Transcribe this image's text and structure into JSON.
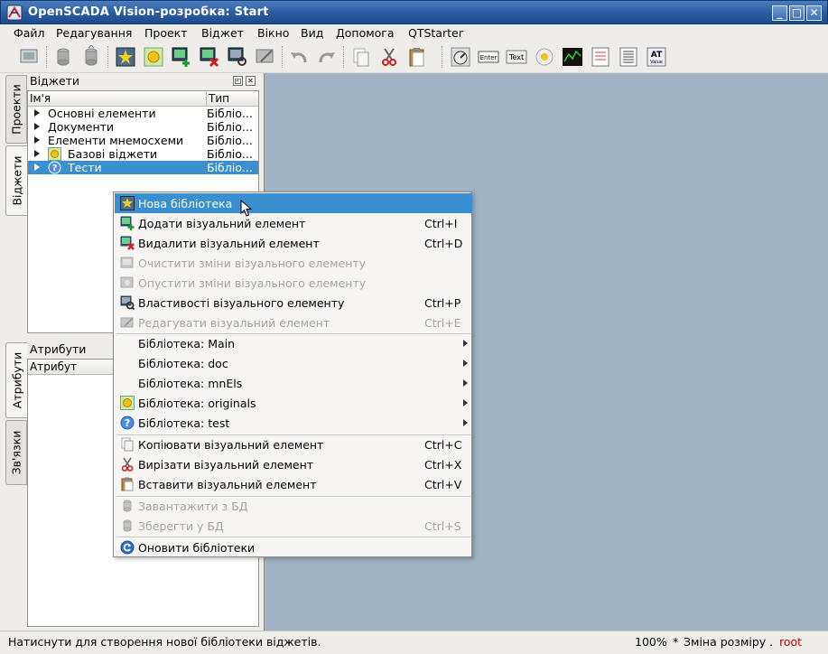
{
  "window": {
    "title": "OpenSCADA Vision-розробка: Start",
    "controls": [
      "_",
      "□",
      "✕"
    ]
  },
  "menubar": [
    "Файл",
    "Редагування",
    "Проект",
    "Віджет",
    "Вікно",
    "Вид",
    "Допомога",
    "QTStarter"
  ],
  "toolbar": {
    "icons": [
      "db-window-icon",
      "load-db-icon",
      "save-db-icon",
      "new-library-icon",
      "library-icon",
      "add-widget-icon",
      "delete-widget-icon",
      "properties-icon",
      "edit-icon",
      "undo-icon",
      "redo-icon",
      "copy-icon",
      "cut-icon",
      "paste-icon",
      "lib-gauge-icon",
      "lib-input-icon",
      "lib-text-icon",
      "lib-flower-icon",
      "lib-trend-icon",
      "lib-doc-icon",
      "lib-table-icon",
      "lib-value-icon"
    ],
    "text_badges": {
      "input": "Enter",
      "text": "Text",
      "value": "Value"
    }
  },
  "left_tabs": {
    "top": [
      "Проекти",
      "Віджети"
    ],
    "bottom": [
      "Атрибути",
      "Зв'язки"
    ]
  },
  "widgets_panel": {
    "title": "Віджети",
    "columns": [
      "Ім'я",
      "Тип"
    ],
    "rows": [
      {
        "name": "Основні елементи",
        "type": "Бібліо..."
      },
      {
        "name": "Документи",
        "type": "Бібліо..."
      },
      {
        "name": "Елементи мнемосхеми",
        "type": "Бібліо..."
      },
      {
        "name": "Базові віджети",
        "type": "Бібліо..."
      },
      {
        "name": "Тести",
        "type": "Бібліо..."
      }
    ]
  },
  "attributes_panel": {
    "title": "Атрибути",
    "columns": [
      "Атрибут"
    ]
  },
  "context_menu": {
    "items": [
      {
        "label": "Нова бібліотека",
        "shortcut": "",
        "icon": "new-library-icon"
      },
      {
        "label": "Додати візуальний елемент",
        "shortcut": "Ctrl+I",
        "icon": "add-widget-icon"
      },
      {
        "label": "Видалити візуальний елемент",
        "shortcut": "Ctrl+D",
        "icon": "delete-widget-icon"
      },
      {
        "label": "Очистити зміни візуального елементу",
        "shortcut": "",
        "icon": "clear-changes-icon"
      },
      {
        "label": "Опустити зміни візуального елементу",
        "shortcut": "",
        "icon": "drop-changes-icon"
      },
      {
        "label": "Властивості візуального елементу",
        "shortcut": "Ctrl+P",
        "icon": "properties-icon"
      },
      {
        "label": "Редагувати візуальний елемент",
        "shortcut": "Ctrl+E",
        "icon": "edit-icon"
      },
      {
        "label": "Бібліотека: Main",
        "shortcut": "",
        "icon": ""
      },
      {
        "label": "Бібліотека: doc",
        "shortcut": "",
        "icon": ""
      },
      {
        "label": "Бібліотека: mnEls",
        "shortcut": "",
        "icon": ""
      },
      {
        "label": "Бібліотека: originals",
        "shortcut": "",
        "icon": "library-icon"
      },
      {
        "label": "Бібліотека: test",
        "shortcut": "",
        "icon": "question-icon"
      },
      {
        "label": "Копіювати візуальний елемент",
        "shortcut": "Ctrl+C",
        "icon": "copy-icon"
      },
      {
        "label": "Вирізати візуальний елемент",
        "shortcut": "Ctrl+X",
        "icon": "cut-icon"
      },
      {
        "label": "Вставити візуальний елемент",
        "shortcut": "Ctrl+V",
        "icon": "paste-icon"
      },
      {
        "label": "Завантажити з БД",
        "shortcut": "",
        "icon": "load-db-icon"
      },
      {
        "label": "Зберегти у БД",
        "shortcut": "Ctrl+S",
        "icon": "save-db-icon"
      },
      {
        "label": "Оновити бібліотеки",
        "shortcut": "",
        "icon": "refresh-icon"
      }
    ]
  },
  "statusbar": {
    "message": "Натиснути для створення нової бібліотеки віджетів.",
    "zoom": "100%",
    "modified": "*",
    "resize": "Зміна розміру",
    "dot": ".",
    "user": "root"
  },
  "colors": {
    "selection": "#3a8fd0",
    "workspace": "#9fb3c5",
    "user": "#c00000"
  }
}
